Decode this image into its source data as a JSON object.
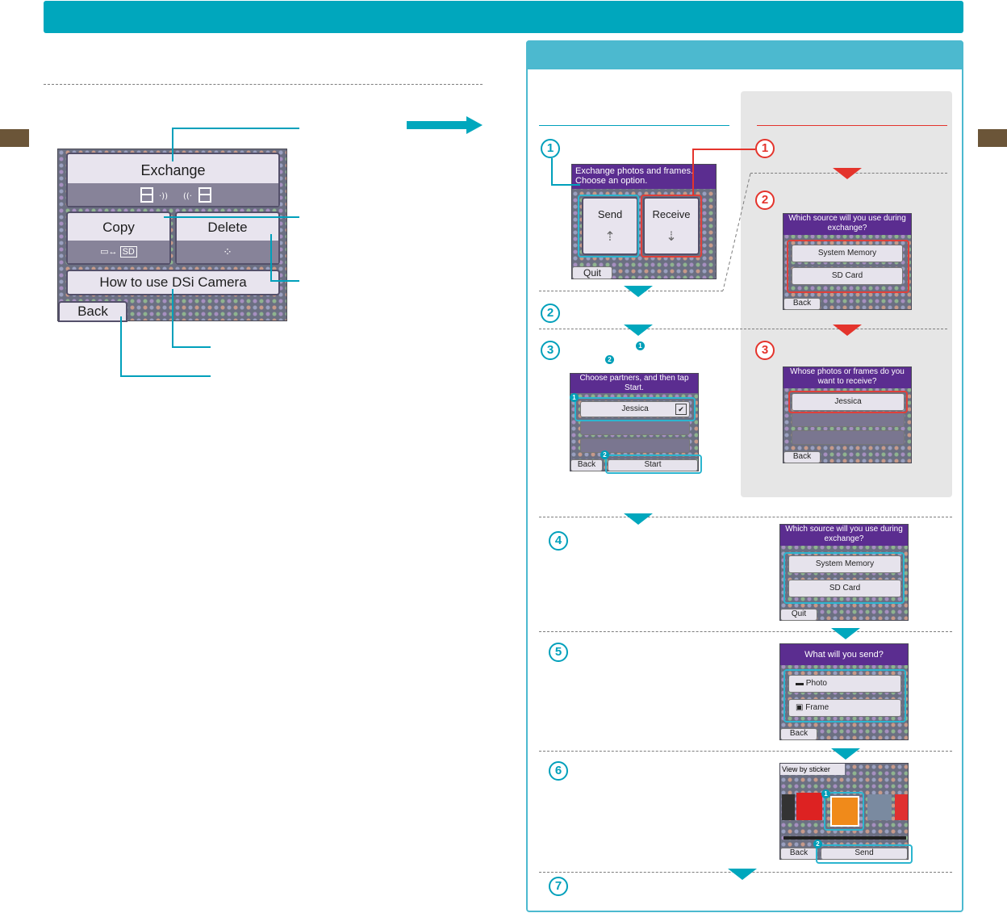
{
  "main_menu": {
    "exchange": "Exchange",
    "copy": "Copy",
    "delete": "Delete",
    "how_to": "How to use DSi Camera",
    "back": "Back",
    "copy_sd": "SD"
  },
  "screens": {
    "s1": {
      "prompt": "Exchange photos and frames. Choose an option.",
      "send": "Send",
      "receive": "Receive",
      "quit": "Quit"
    },
    "s3": {
      "prompt": "Choose partners, and then tap Start.",
      "partner": "Jessica",
      "back": "Back",
      "start": "Start"
    },
    "r2": {
      "prompt": "Which source will you use during exchange?",
      "opt1": "System Memory",
      "opt2": "SD Card",
      "back": "Back"
    },
    "r3": {
      "prompt": "Whose photos or frames do you want to receive?",
      "partner": "Jessica",
      "back": "Back"
    },
    "s4": {
      "prompt": "Which source will you use during exchange?",
      "opt1": "System Memory",
      "opt2": "SD Card",
      "quit": "Quit"
    },
    "s5": {
      "prompt": "What will you send?",
      "opt1": "Photo",
      "opt2": "Frame",
      "back": "Back"
    },
    "s6": {
      "label": "View by sticker",
      "back": "Back",
      "send": "Send"
    }
  },
  "steps": {
    "n1": "1",
    "n2": "2",
    "n3": "3",
    "n4": "4",
    "n5": "5",
    "n6": "6",
    "n7": "7",
    "m1": "1",
    "m2": "2"
  },
  "colors": {
    "teal": "#00a7bd",
    "red": "#e4342c",
    "purple": "#5b2d90"
  }
}
